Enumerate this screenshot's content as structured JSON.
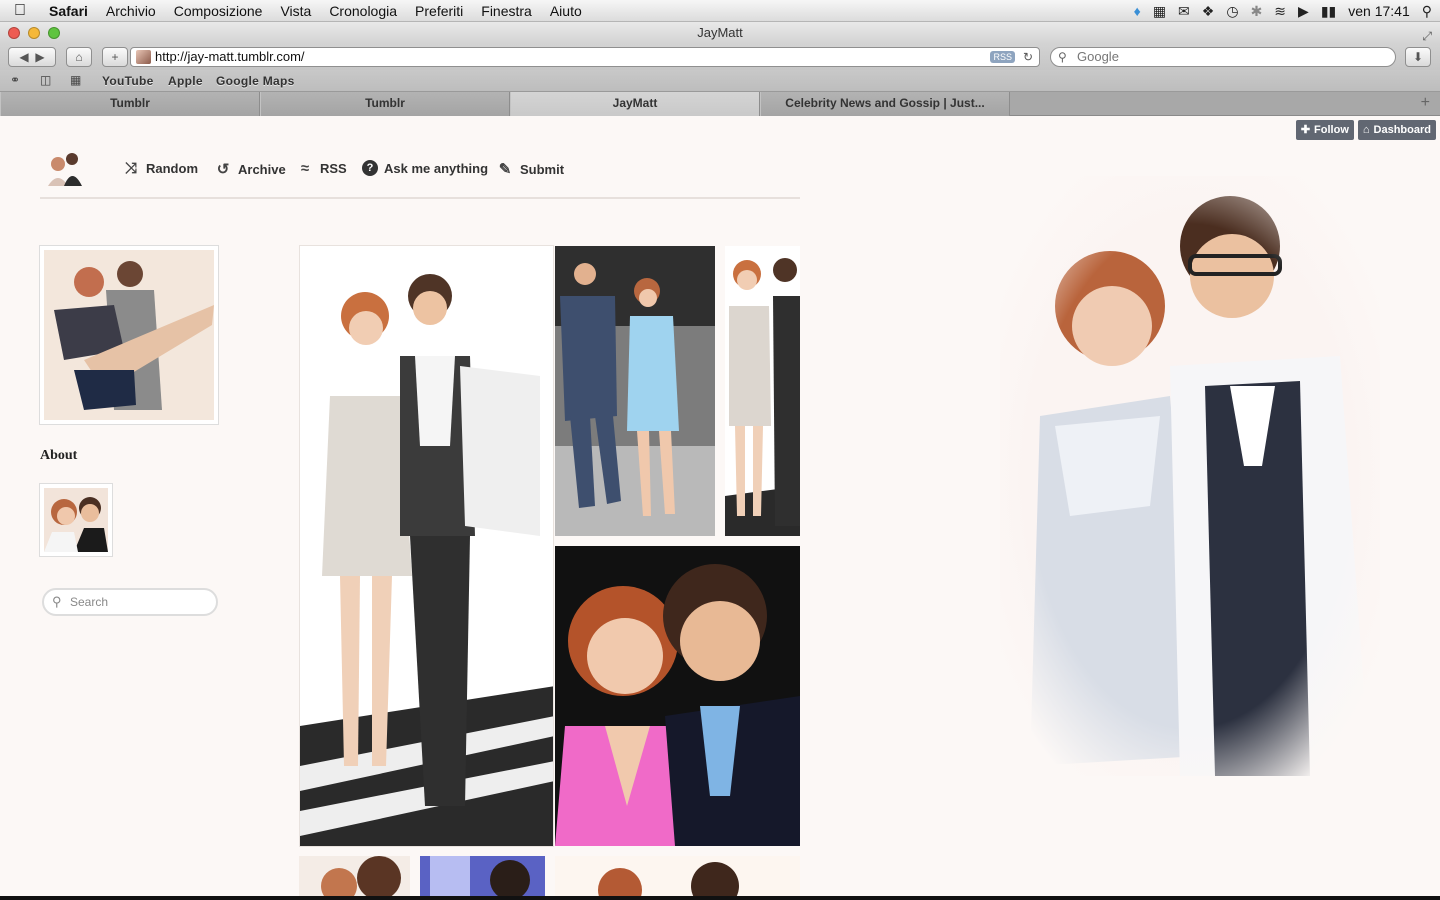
{
  "menubar": {
    "app_name": "Safari",
    "items": [
      "Archivio",
      "Composizione",
      "Vista",
      "Cronologia",
      "Preferiti",
      "Finestra",
      "Aiuto"
    ],
    "clock": "ven 17:41"
  },
  "window": {
    "title": "JayMatt",
    "url": "http://jay-matt.tumblr.com/",
    "rss_badge": "RSS",
    "search_placeholder": "Google"
  },
  "bookmarks": [
    "YouTube",
    "Apple",
    "Google Maps"
  ],
  "tabs": [
    {
      "label": "Tumblr",
      "active": false
    },
    {
      "label": "Tumblr",
      "active": false
    },
    {
      "label": "JayMatt",
      "active": true
    },
    {
      "label": "Celebrity News and Gossip | Just...",
      "active": false
    }
  ],
  "tumblr_controls": {
    "follow": "Follow",
    "dashboard": "Dashboard"
  },
  "nav": {
    "items": [
      {
        "label": "Random",
        "icon": "shuffle-icon"
      },
      {
        "label": "Archive",
        "icon": "clock-history-icon"
      },
      {
        "label": "RSS",
        "icon": "rss-icon"
      },
      {
        "label": "Ask me anything",
        "icon": "question-icon"
      },
      {
        "label": "Submit",
        "icon": "edit-icon"
      }
    ]
  },
  "sidebar": {
    "about_title": "About",
    "search_placeholder": "Search"
  },
  "colors": {
    "page_bg": "#fcf8f6",
    "nav_text": "#333333",
    "tumblr_control_bg": "#2d3746"
  }
}
